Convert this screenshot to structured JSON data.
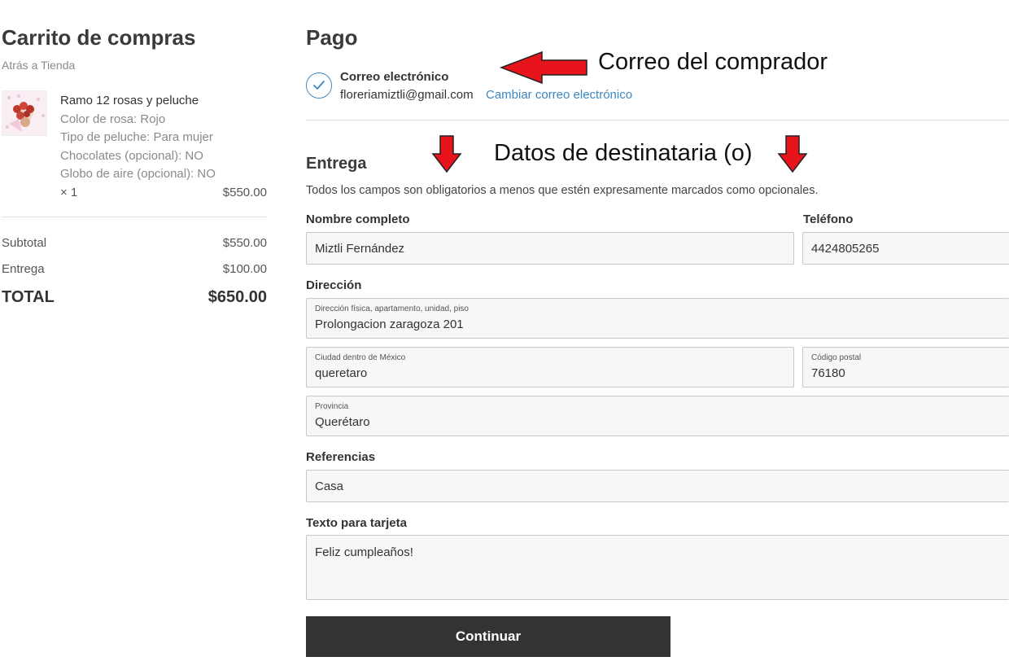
{
  "cart": {
    "title": "Carrito de compras",
    "back_link": "Atrás a Tienda",
    "item": {
      "name": "Ramo 12 rosas y peluche",
      "options": [
        "Color de rosa: Rojo",
        "Tipo de peluche: Para mujer",
        "Chocolates (opcional): NO",
        "Globo de aire (opcional): NO"
      ],
      "quantity": "× 1",
      "price": "$550.00"
    },
    "subtotal_label": "Subtotal",
    "subtotal_value": "$550.00",
    "delivery_label": "Entrega",
    "delivery_value": "$100.00",
    "total_label": "TOTAL",
    "total_value": "$650.00"
  },
  "payment": {
    "title": "Pago",
    "email_label": "Correo electrónico",
    "email_value": "floreriamiztli@gmail.com",
    "change_email": "Cambiar correo electrónico"
  },
  "annotations": {
    "buyer_email": "Correo del comprador",
    "recipient_data": "Datos de destinataria (o)",
    "arrow_color": "#e8141b"
  },
  "delivery": {
    "title": "Entrega",
    "note": "Todos los campos son obligatorios a menos que estén expresamente marcados como opcionales.",
    "full_name_label": "Nombre completo",
    "full_name_value": "Miztli Fernández",
    "phone_label": "Teléfono",
    "phone_value": "4424805265",
    "address_label": "Dirección",
    "street_label": "Dirección física, apartamento, unidad, piso",
    "street_value": "Prolongacion zaragoza 201",
    "city_label": "Ciudad dentro de México",
    "city_value": "queretaro",
    "postal_label": "Código postal",
    "postal_value": "76180",
    "province_label": "Provincia",
    "province_value": "Querétaro",
    "references_label": "Referencias",
    "references_value": "Casa",
    "card_text_label": "Texto para tarjeta",
    "card_text_value": "Feliz cumpleaños!",
    "continue_button": "Continuar"
  }
}
